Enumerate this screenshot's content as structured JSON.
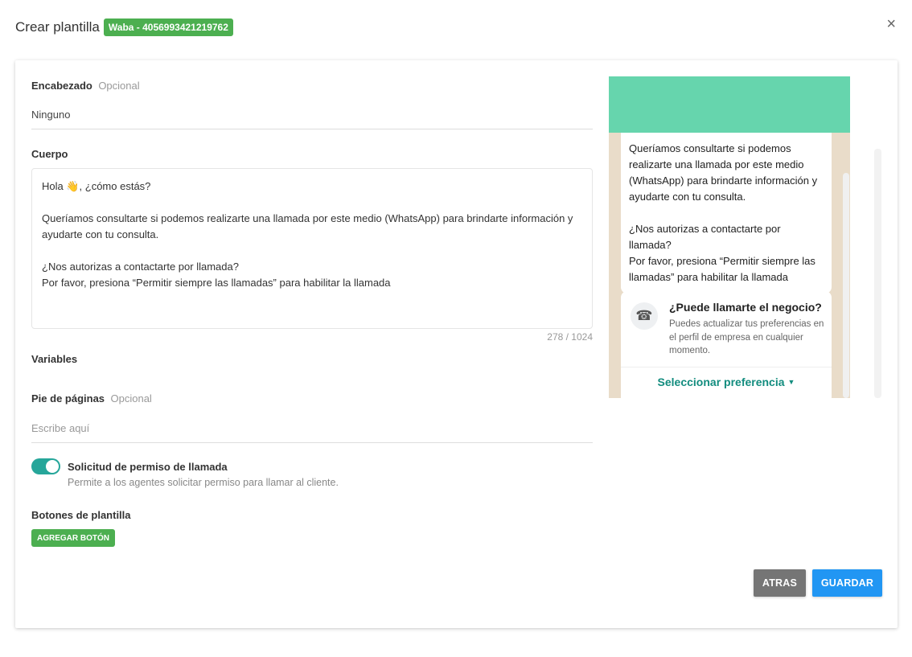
{
  "header": {
    "title": "Crear plantilla",
    "waba_badge": "Waba - 4056993421219762",
    "close_label": "×"
  },
  "form": {
    "encabezado": {
      "label": "Encabezado",
      "optional": "Opcional",
      "value": "Ninguno"
    },
    "cuerpo": {
      "label": "Cuerpo",
      "text": "Hola 👋, ¿cómo estás?\n\nQueríamos consultarte si podemos realizarte una llamada por este medio (WhatsApp) para brindarte información y ayudarte con tu consulta.\n\n¿Nos autorizas a contactarte por llamada?\nPor favor, presiona “Permitir siempre las llamadas” para habilitar la llamada",
      "counter": "278 / 1024"
    },
    "variables": {
      "label": "Variables"
    },
    "pie": {
      "label": "Pie de páginas",
      "optional": "Opcional",
      "placeholder": "Escribe aquí"
    },
    "permiso": {
      "label": "Solicitud de permiso de llamada",
      "description": "Permite a los agentes solicitar permiso para llamar al cliente.",
      "enabled": true
    },
    "botones": {
      "label": "Botones de plantilla",
      "add_label": "AGREGAR BOTÓN"
    }
  },
  "preview": {
    "bubble_text": "Queríamos consultarte si podemos realizarte una llamada por este medio (WhatsApp) para brindarte información y ayudarte con tu consulta.\n\n¿Nos autorizas a contactarte por llamada?\nPor favor, presiona “Permitir siempre las llamadas” para habilitar la llamada",
    "call_title": "¿Puede llamarte el negocio?",
    "call_description": "Puedes actualizar tus preferencias en el perfil de empresa en cualquier momento.",
    "call_select_label": "Seleccionar preferencia",
    "call_icon": "phone-icon"
  },
  "actions": {
    "back_label": "ATRAS",
    "save_label": "GUARDAR"
  },
  "colors": {
    "badge": "#4caf50",
    "toggle": "#26a69a",
    "phone_header": "#66d5ad",
    "chat_bg": "#e9dcc9",
    "link": "#128c7e",
    "back": "#757575",
    "save": "#2196f3"
  }
}
